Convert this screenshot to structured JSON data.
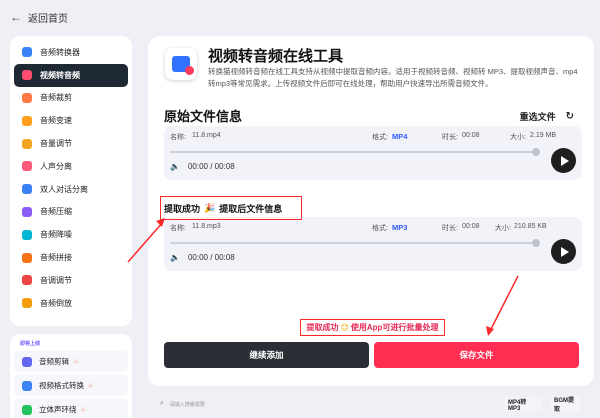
{
  "topbar": {
    "back_label": "返回首页"
  },
  "sidebar": {
    "items": [
      {
        "label": "音频转换器",
        "color": "#3b82f6"
      },
      {
        "label": "视频转音频",
        "color": "#ff4d6d",
        "active": true
      },
      {
        "label": "音频裁剪",
        "color": "#ff7a45"
      },
      {
        "label": "音频变速",
        "color": "#ff9f1c"
      },
      {
        "label": "音量调节",
        "color": "#f5a524"
      },
      {
        "label": "人声分离",
        "color": "#ff5a7a"
      },
      {
        "label": "双人对话分离",
        "color": "#3b82f6"
      },
      {
        "label": "音频压缩",
        "color": "#8b5cf6"
      },
      {
        "label": "音频降噪",
        "color": "#06b6d4"
      },
      {
        "label": "音频拼接",
        "color": "#f97316"
      },
      {
        "label": "音调调节",
        "color": "#ef4444"
      },
      {
        "label": "音频倒放",
        "color": "#f59e0b"
      }
    ]
  },
  "sidebar_upcoming": {
    "title": "即将上线",
    "items": [
      {
        "label": "音频剪辑",
        "color": "#6366f1"
      },
      {
        "label": "视频格式转换",
        "color": "#3b82f6"
      },
      {
        "label": "立体声环绕",
        "color": "#22c55e"
      }
    ]
  },
  "main": {
    "title": "视频转音频在线工具",
    "description": "转换猫视频转音频在线工具支持从视频中提取音频内容。适用于视频转音频、视频转 MP3、提取视频声音、mp4转mp3等常见需求。上传视频文件后即可在线处理，帮助用户快速导出所需音频文件。",
    "original_section_title": "原始文件信息",
    "reselect_label": "重选文件",
    "original_file": {
      "name_label": "名称:",
      "name": "11.8.mp4",
      "format_label": "格式:",
      "format": "MP4",
      "duration_label": "时长:",
      "duration": "00:08",
      "size_label": "大小:",
      "size": "2.19 MB",
      "time_display": "00:00 / 00:08"
    },
    "success_label": "提取成功",
    "extracted_section_title": "提取后文件信息",
    "extracted_file": {
      "name_label": "名称:",
      "name": "11.8.mp3",
      "format_label": "格式:",
      "format": "MP3",
      "duration_label": "时长:",
      "duration": "00:08",
      "size_label": "大小:",
      "size": "210.85 KB",
      "time_display": "00:00 / 00:08"
    },
    "batch_notice_prefix": "提取成功",
    "batch_notice_suffix": "使用App可进行批量处理",
    "continue_button": "继续添加",
    "save_button": "保存文件"
  },
  "bottombar": {
    "search_placeholder": "请输入搜索需要",
    "chips": [
      "MP4转MP3",
      "BGM提取"
    ]
  },
  "colors": {
    "accent_red": "#ff2e52",
    "annotation_red": "#ff2a2a",
    "format_blue": "#2f5bff",
    "dark": "#1f2933"
  }
}
